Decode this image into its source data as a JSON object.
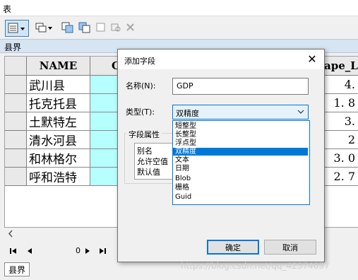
{
  "window": {
    "title": "表"
  },
  "table_tab": {
    "label": "县界"
  },
  "table": {
    "columns": [
      "NAME",
      "C",
      "ape_L"
    ],
    "rows": [
      {
        "name": "武川县",
        "value": "4."
      },
      {
        "name": "托克托县",
        "value": "1. 8"
      },
      {
        "name": "土默特左",
        "value": "3."
      },
      {
        "name": "清水河县",
        "value": "2"
      },
      {
        "name": "和林格尔",
        "value": "3. 0"
      },
      {
        "name": "呼和浩特",
        "value": "2. 7"
      }
    ]
  },
  "navigation": {
    "record": "0"
  },
  "bottom_tab": {
    "label": "县界"
  },
  "dialog": {
    "title": "添加字段",
    "close_glyph": "✕",
    "name_label": "名称(N):",
    "name_value": "GDP",
    "type_label": "类型(T):",
    "type_value": "双精度",
    "group_title": "字段属性",
    "properties": [
      "别名",
      "允许空值",
      "默认值"
    ],
    "type_options": [
      "短整型",
      "长整型",
      "浮点型",
      "双精度",
      "文本",
      "日期",
      "Blob",
      "栅格",
      "Guid"
    ],
    "selected_option": "双精度",
    "ok_label": "确定",
    "cancel_label": "取消"
  },
  "watermark": "https://blog.csdn.net/qq_42374697"
}
